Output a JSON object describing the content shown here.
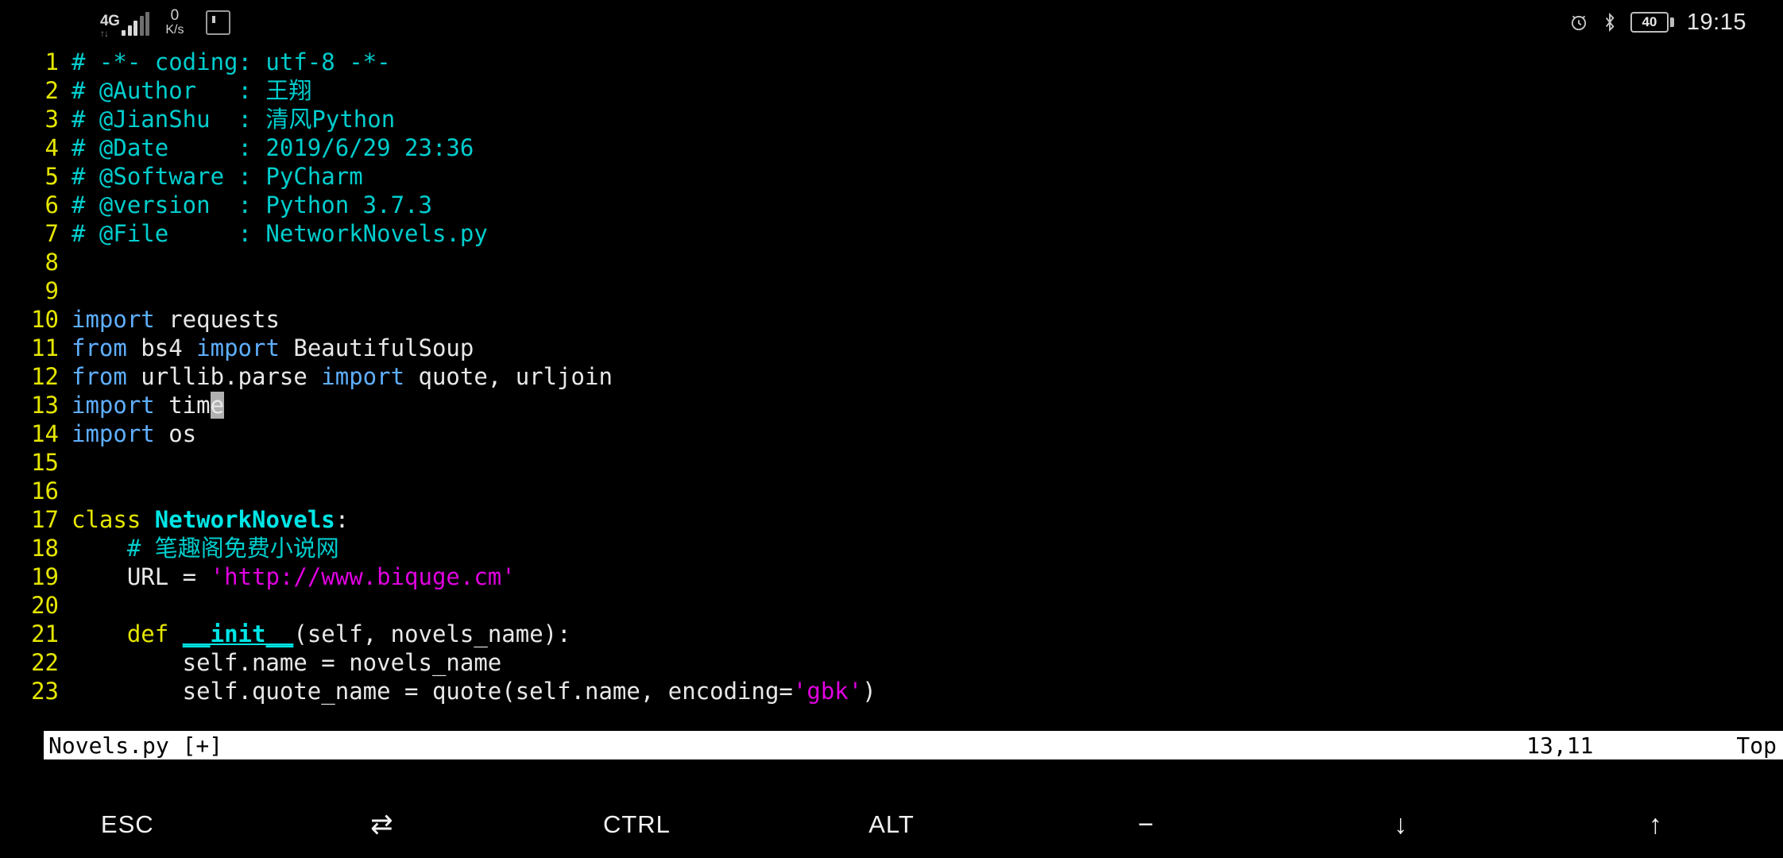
{
  "statusbar": {
    "network_type": "4G",
    "network_sub": "↑↓",
    "speed_value": "0",
    "speed_unit": "K/s",
    "sim_icon": "sim-card-icon",
    "alarm_icon": "alarm-icon",
    "bluetooth_icon": "bluetooth-icon",
    "battery_level": "40",
    "clock": "19:15"
  },
  "editor": {
    "lines": [
      {
        "no": "1",
        "tokens": [
          {
            "t": "# -*- coding: utf-8 -*-",
            "c": "tok-comment"
          }
        ]
      },
      {
        "no": "2",
        "tokens": [
          {
            "t": "# @Author   : 王翔",
            "c": "tok-comment"
          }
        ]
      },
      {
        "no": "3",
        "tokens": [
          {
            "t": "# @JianShu  : 清风Python",
            "c": "tok-comment"
          }
        ]
      },
      {
        "no": "4",
        "tokens": [
          {
            "t": "# @Date     : 2019/6/29 23:36",
            "c": "tok-comment"
          }
        ]
      },
      {
        "no": "5",
        "tokens": [
          {
            "t": "# @Software : PyCharm",
            "c": "tok-comment"
          }
        ]
      },
      {
        "no": "6",
        "tokens": [
          {
            "t": "# @version  : Python 3.7.3",
            "c": "tok-comment"
          }
        ]
      },
      {
        "no": "7",
        "tokens": [
          {
            "t": "# @File     : NetworkNovels.py",
            "c": "tok-comment"
          }
        ]
      },
      {
        "no": "8",
        "tokens": []
      },
      {
        "no": "9",
        "tokens": []
      },
      {
        "no": "10",
        "tokens": [
          {
            "t": "import",
            "c": "tok-kw"
          },
          {
            "t": " requests",
            "c": "tok-plain"
          }
        ]
      },
      {
        "no": "11",
        "tokens": [
          {
            "t": "from",
            "c": "tok-kw"
          },
          {
            "t": " bs4 ",
            "c": "tok-plain"
          },
          {
            "t": "import",
            "c": "tok-kw"
          },
          {
            "t": " BeautifulSoup",
            "c": "tok-plain"
          }
        ]
      },
      {
        "no": "12",
        "tokens": [
          {
            "t": "from",
            "c": "tok-kw"
          },
          {
            "t": " urllib.parse ",
            "c": "tok-plain"
          },
          {
            "t": "import",
            "c": "tok-kw"
          },
          {
            "t": " quote, urljoin",
            "c": "tok-plain"
          }
        ]
      },
      {
        "no": "13",
        "tokens": [
          {
            "t": "import",
            "c": "tok-kw"
          },
          {
            "t": " tim",
            "c": "tok-plain"
          },
          {
            "t": "e",
            "c": "cursor"
          }
        ]
      },
      {
        "no": "14",
        "tokens": [
          {
            "t": "import",
            "c": "tok-kw"
          },
          {
            "t": " os",
            "c": "tok-plain"
          }
        ]
      },
      {
        "no": "15",
        "tokens": []
      },
      {
        "no": "16",
        "tokens": []
      },
      {
        "no": "17",
        "tokens": [
          {
            "t": "class",
            "c": "tok-classkw"
          },
          {
            "t": " ",
            "c": "tok-plain"
          },
          {
            "t": "NetworkNovels",
            "c": "tok-classname"
          },
          {
            "t": ":",
            "c": "tok-plain"
          }
        ]
      },
      {
        "no": "18",
        "tokens": [
          {
            "t": "    # 笔趣阁免费小说网",
            "c": "tok-comment"
          }
        ]
      },
      {
        "no": "19",
        "tokens": [
          {
            "t": "    URL = ",
            "c": "tok-plain"
          },
          {
            "t": "'http://www.biquge.cm'",
            "c": "tok-string"
          }
        ]
      },
      {
        "no": "20",
        "tokens": []
      },
      {
        "no": "21",
        "tokens": [
          {
            "t": "    ",
            "c": "tok-plain"
          },
          {
            "t": "def",
            "c": "tok-defkw"
          },
          {
            "t": " ",
            "c": "tok-plain"
          },
          {
            "t": "__init__",
            "c": "tok-func"
          },
          {
            "t": "(self, novels_name):",
            "c": "tok-plain"
          }
        ]
      },
      {
        "no": "22",
        "tokens": [
          {
            "t": "        self.name = novels_name",
            "c": "tok-plain"
          }
        ]
      },
      {
        "no": "23",
        "tokens": [
          {
            "t": "        self.quote_name = quote(self.name, encoding=",
            "c": "tok-plain"
          },
          {
            "t": "'gbk'",
            "c": "tok-string"
          },
          {
            "t": ")",
            "c": "tok-plain"
          }
        ]
      }
    ]
  },
  "vim_status": {
    "filename": "Novels.py [+]",
    "position": "13,11",
    "scroll": "Top"
  },
  "extra_keys": [
    {
      "label": "ESC",
      "name": "key-esc"
    },
    {
      "label": "⇄",
      "name": "key-tab"
    },
    {
      "label": "CTRL",
      "name": "key-ctrl"
    },
    {
      "label": "ALT",
      "name": "key-alt"
    },
    {
      "label": "−",
      "name": "key-minus"
    },
    {
      "label": "↓",
      "name": "key-arrow-down"
    },
    {
      "label": "↑",
      "name": "key-arrow-up"
    }
  ],
  "colors": {
    "background": "#000000",
    "comment": "#00cdcd",
    "keyword": "#5fafff",
    "string": "#e000e0",
    "lineno": "#e5e500",
    "cursor": "#b0b0b0",
    "status_bg": "#ffffff"
  }
}
